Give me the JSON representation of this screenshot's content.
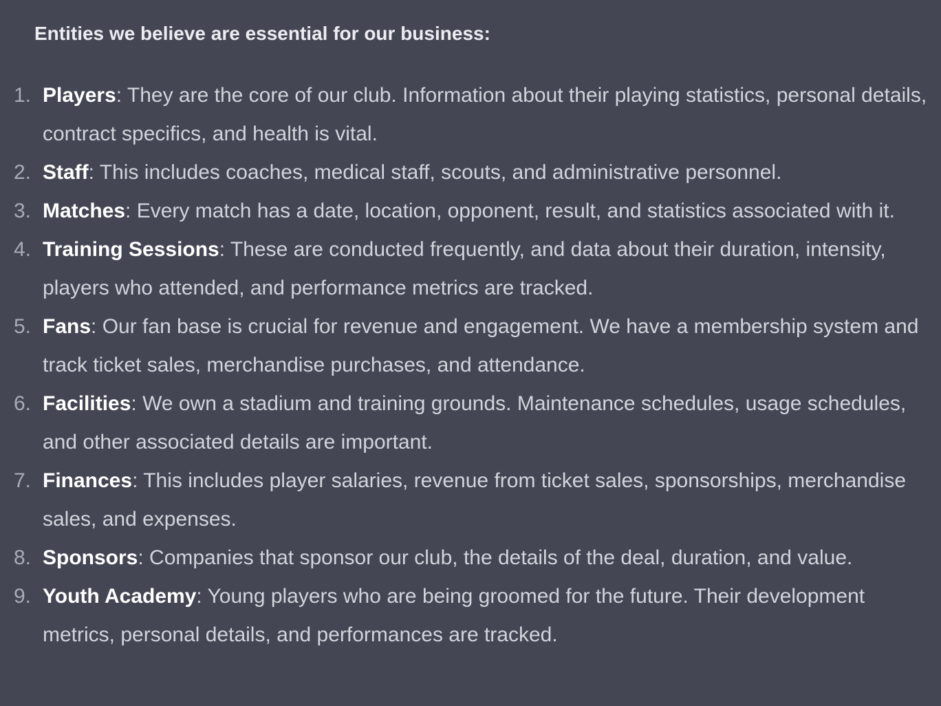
{
  "heading": "Entities we believe are essential for our business:",
  "entities": [
    {
      "number": "1.",
      "name": "Players",
      "description": ": They are the core of our club. Information about their playing statistics, personal details, contract specifics, and health is vital."
    },
    {
      "number": "2.",
      "name": "Staff",
      "description": ": This includes coaches, medical staff, scouts, and administrative personnel."
    },
    {
      "number": "3.",
      "name": "Matches",
      "description": ": Every match has a date, location, opponent, result, and statistics associated with it."
    },
    {
      "number": "4.",
      "name": "Training Sessions",
      "description": ": These are conducted frequently, and data about their duration, intensity, players who attended, and performance metrics are tracked."
    },
    {
      "number": "5.",
      "name": "Fans",
      "description": ": Our fan base is crucial for revenue and engagement. We have a membership system and track ticket sales, merchandise purchases, and attendance."
    },
    {
      "number": "6.",
      "name": "Facilities",
      "description": ": We own a stadium and training grounds. Maintenance schedules, usage schedules, and other associated details are important."
    },
    {
      "number": "7.",
      "name": "Finances",
      "description": ": This includes player salaries, revenue from ticket sales, sponsorships, merchandise sales, and expenses."
    },
    {
      "number": "8.",
      "name": "Sponsors",
      "description": ": Companies that sponsor our club, the details of the deal, duration, and value."
    },
    {
      "number": "9.",
      "name": "Youth Academy",
      "description": ": Young players who are being groomed for the future. Their development metrics, personal details, and performances are tracked."
    }
  ]
}
